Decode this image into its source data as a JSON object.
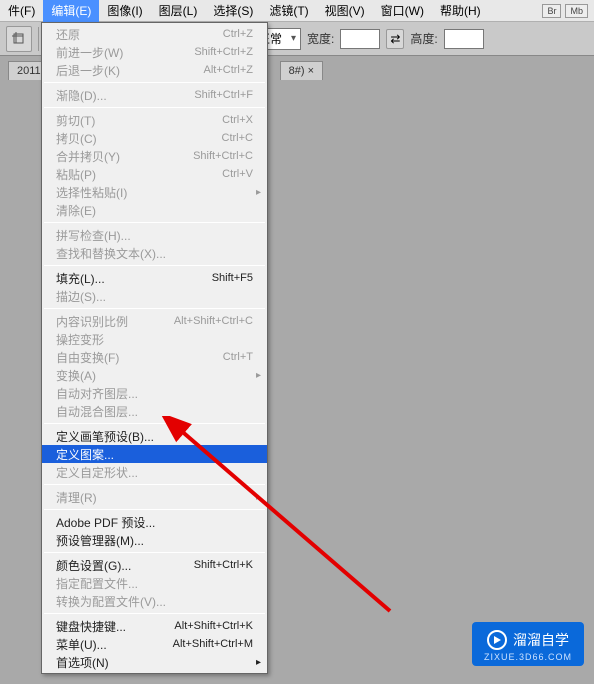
{
  "menubar": {
    "items": [
      {
        "label": "件(F)"
      },
      {
        "label": "编辑(E)"
      },
      {
        "label": "图像(I)"
      },
      {
        "label": "图层(L)"
      },
      {
        "label": "选择(S)"
      },
      {
        "label": "滤镜(T)"
      },
      {
        "label": "视图(V)"
      },
      {
        "label": "窗口(W)"
      },
      {
        "label": "帮助(H)"
      }
    ],
    "right": [
      "Br",
      "Mb"
    ]
  },
  "toolbar": {
    "mode_label": "正常",
    "width_label": "宽度:",
    "height_label": "高度:"
  },
  "tabbar": {
    "tab_label": "2011",
    "tab_suffix": "8#) ×"
  },
  "menu": {
    "groups": [
      [
        {
          "label": "还原",
          "shortcut": "Ctrl+Z",
          "disabled": true
        },
        {
          "label": "前进一步(W)",
          "shortcut": "Shift+Ctrl+Z",
          "disabled": true
        },
        {
          "label": "后退一步(K)",
          "shortcut": "Alt+Ctrl+Z",
          "disabled": true
        }
      ],
      [
        {
          "label": "渐隐(D)...",
          "shortcut": "Shift+Ctrl+F",
          "disabled": true
        }
      ],
      [
        {
          "label": "剪切(T)",
          "shortcut": "Ctrl+X",
          "disabled": true
        },
        {
          "label": "拷贝(C)",
          "shortcut": "Ctrl+C",
          "disabled": true
        },
        {
          "label": "合并拷贝(Y)",
          "shortcut": "Shift+Ctrl+C",
          "disabled": true
        },
        {
          "label": "粘贴(P)",
          "shortcut": "Ctrl+V",
          "disabled": true
        },
        {
          "label": "选择性粘贴(I)",
          "submenu": true,
          "disabled": true
        },
        {
          "label": "清除(E)",
          "disabled": true
        }
      ],
      [
        {
          "label": "拼写检查(H)...",
          "disabled": true
        },
        {
          "label": "查找和替换文本(X)...",
          "disabled": true
        }
      ],
      [
        {
          "label": "填充(L)...",
          "shortcut": "Shift+F5"
        },
        {
          "label": "描边(S)...",
          "disabled": true
        }
      ],
      [
        {
          "label": "内容识别比例",
          "shortcut": "Alt+Shift+Ctrl+C",
          "disabled": true
        },
        {
          "label": "操控变形",
          "disabled": true
        },
        {
          "label": "自由变换(F)",
          "shortcut": "Ctrl+T",
          "disabled": true
        },
        {
          "label": "变换(A)",
          "submenu": true,
          "disabled": true
        },
        {
          "label": "自动对齐图层...",
          "disabled": true
        },
        {
          "label": "自动混合图层...",
          "disabled": true
        }
      ],
      [
        {
          "label": "定义画笔预设(B)..."
        },
        {
          "label": "定义图案...",
          "highlighted": true
        },
        {
          "label": "定义自定形状...",
          "disabled": true
        }
      ],
      [
        {
          "label": "清理(R)",
          "submenu": true,
          "disabled": true
        }
      ],
      [
        {
          "label": "Adobe PDF 预设..."
        },
        {
          "label": "预设管理器(M)..."
        }
      ],
      [
        {
          "label": "颜色设置(G)...",
          "shortcut": "Shift+Ctrl+K"
        },
        {
          "label": "指定配置文件...",
          "disabled": true
        },
        {
          "label": "转换为配置文件(V)...",
          "disabled": true
        }
      ],
      [
        {
          "label": "键盘快捷键...",
          "shortcut": "Alt+Shift+Ctrl+K"
        },
        {
          "label": "菜单(U)...",
          "shortcut": "Alt+Shift+Ctrl+M"
        },
        {
          "label": "首选项(N)",
          "submenu": true
        }
      ]
    ]
  },
  "watermark": {
    "brand": "溜溜自学",
    "sub": "ZIXUE.3D66.COM"
  }
}
